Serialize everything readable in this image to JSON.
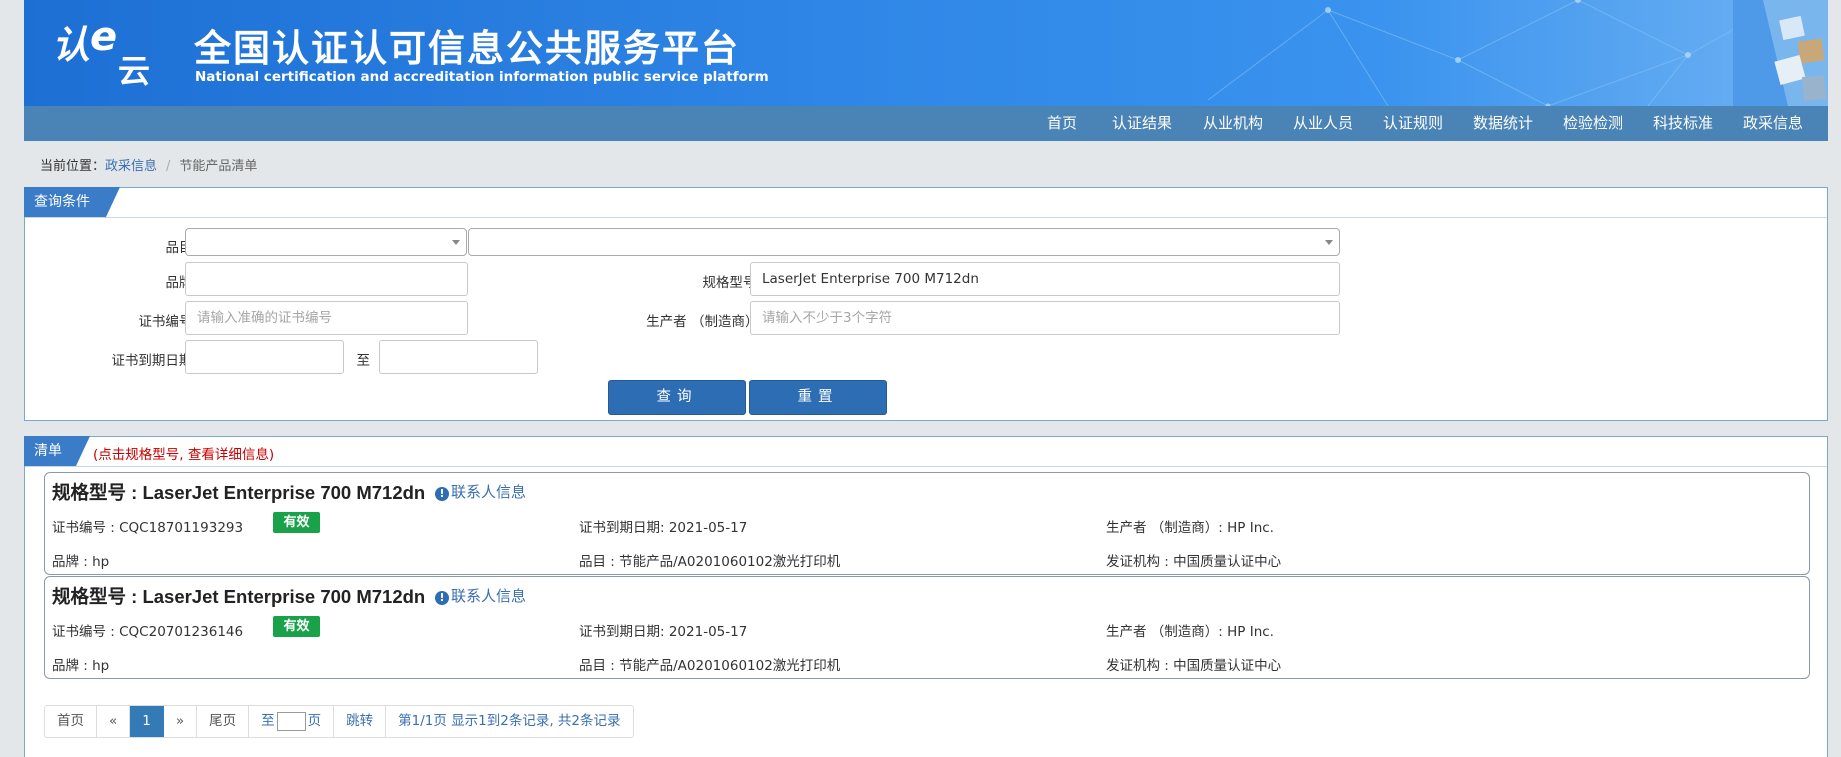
{
  "header": {
    "logo_text": "认e云",
    "title_cn": "全国认证认可信息公共服务平台",
    "title_en": "National certification and accreditation information public service platform",
    "bg_color": "#2f86e6"
  },
  "nav": {
    "items": [
      "首页",
      "认证结果",
      "从业机构",
      "从业人员",
      "认证规则",
      "数据统计",
      "检验检测",
      "科技标准",
      "政采信息"
    ]
  },
  "breadcrumb": {
    "prefix": "当前位置：",
    "link": "政采信息",
    "sep": "/",
    "current": "节能产品清单"
  },
  "query": {
    "tab_label": "查询条件",
    "category_label": "品目:",
    "brand_label": "品牌:",
    "model_label": "规格型号:",
    "model_value": "LaserJet Enterprise 700 M712dn",
    "cert_no_label": "证书编号:",
    "cert_no_placeholder": "请输入准确的证书编号",
    "manufacturer_label": "生产者 （制造商）:",
    "manufacturer_placeholder": "请输入不少于3个字符",
    "expiry_label": "证书到期日期:",
    "to_label": "至",
    "search_button": "查询",
    "reset_button": "重置"
  },
  "list": {
    "tab_label": "清单",
    "note": "(点击规格型号, 查看详细信息)",
    "contact_label": "联系人信息",
    "records": [
      {
        "title": "规格型号 : LaserJet Enterprise 700 M712dn",
        "cert_no": "证书编号 : CQC18701193293",
        "status": "有效",
        "expiry": "证书到期日期: 2021-05-17",
        "manufacturer": "生产者 （制造商）: HP Inc.",
        "brand": "品牌 : hp",
        "category": "品目 : 节能产品/A0201060102激光打印机",
        "issuer": "发证机构 : 中国质量认证中心"
      },
      {
        "title": "规格型号 : LaserJet Enterprise 700 M712dn",
        "cert_no": "证书编号 : CQC20701236146",
        "status": "有效",
        "expiry": "证书到期日期: 2021-05-17",
        "manufacturer": "生产者 （制造商）: HP Inc.",
        "brand": "品牌 : hp",
        "category": "品目 : 节能产品/A0201060102激光打印机",
        "issuer": "发证机构 : 中国质量认证中心"
      }
    ]
  },
  "pager": {
    "first": "首页",
    "prev": "«",
    "current": "1",
    "next": "»",
    "last": "尾页",
    "goto_prefix": "至",
    "goto_suffix": "页",
    "jump": "跳转",
    "summary": "第1/1页  显示1到2条记录, 共2条记录"
  },
  "colors": {
    "nav_bg": "#4a83b5",
    "tab_bg": "#3a7cc8",
    "button_bg": "#2d6db4",
    "status_green": "#19a24a",
    "note_red": "#cc0000"
  }
}
